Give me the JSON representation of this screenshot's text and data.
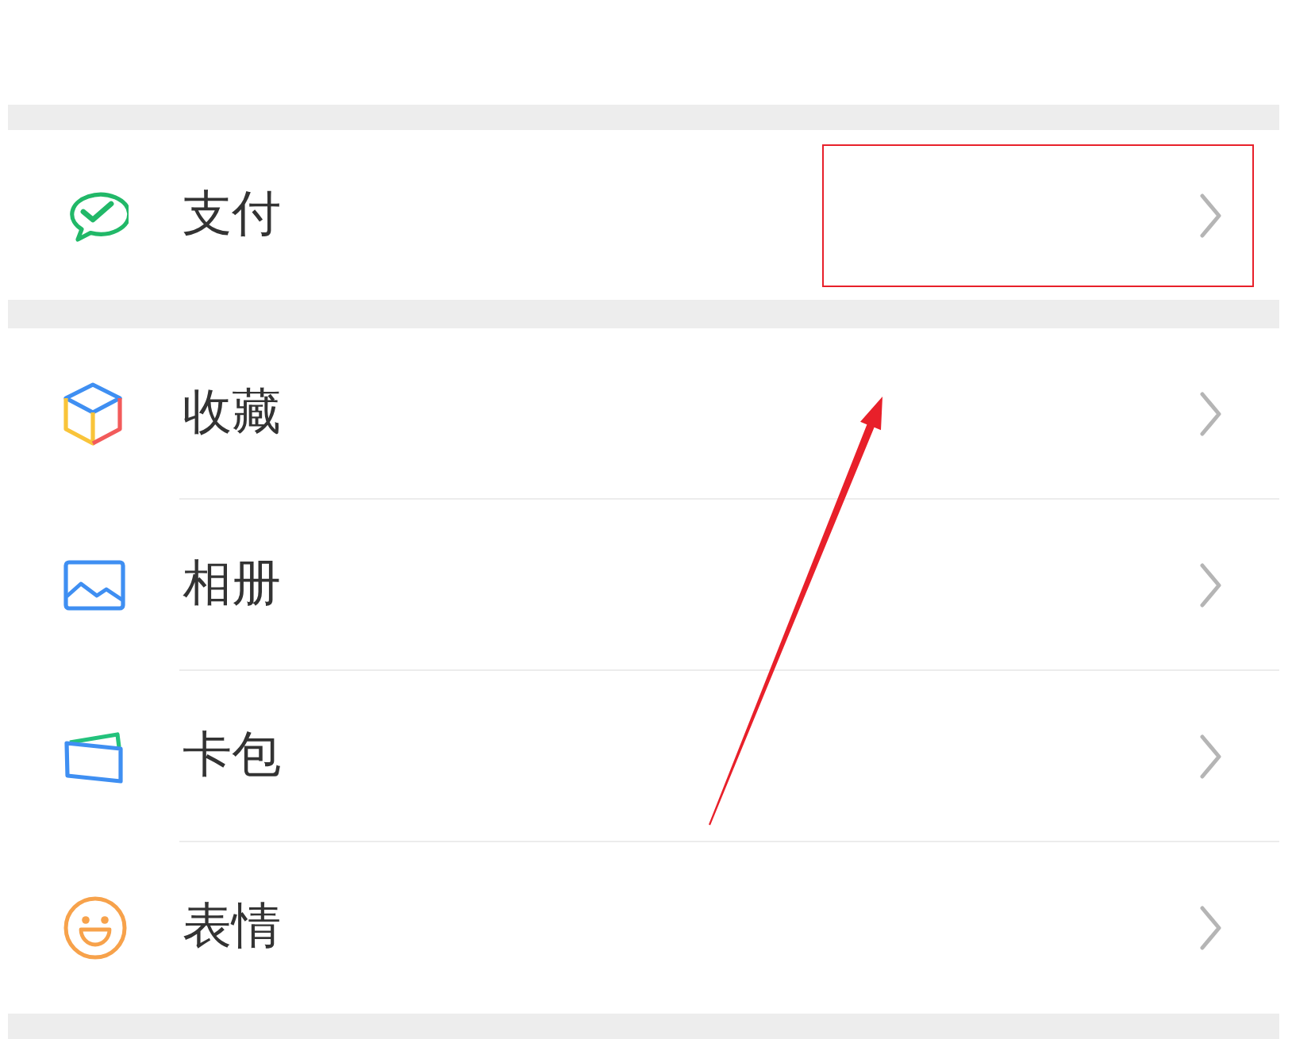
{
  "sections": [
    {
      "items": [
        {
          "label": "支付"
        }
      ]
    },
    {
      "items": [
        {
          "label": "收藏"
        },
        {
          "label": "相册"
        },
        {
          "label": "卡包"
        },
        {
          "label": "表情"
        }
      ]
    }
  ],
  "annotations": [
    {
      "kind": "highlight-box"
    },
    {
      "kind": "arrow"
    }
  ]
}
